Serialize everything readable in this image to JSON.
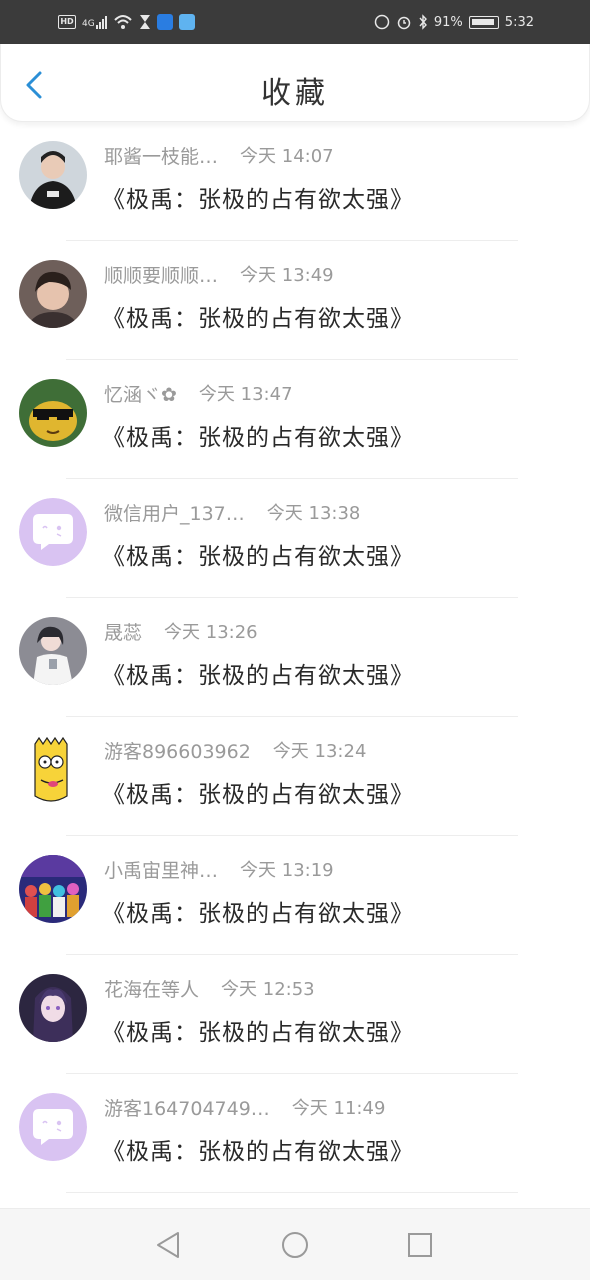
{
  "status_bar": {
    "hd": "HD",
    "network": "4G",
    "battery": "91%",
    "time": "5:32"
  },
  "header": {
    "title": "收藏"
  },
  "items": [
    {
      "name": "耶酱一枝能…",
      "time": "今天 14:07",
      "message": "《极禹：张极的占有欲太强》"
    },
    {
      "name": "顺顺要顺顺…",
      "time": "今天 13:49",
      "message": "《极禹：张极的占有欲太强》"
    },
    {
      "name": "忆涵ヾ✿",
      "time": "今天 13:47",
      "message": "《极禹：张极的占有欲太强》"
    },
    {
      "name": "微信用户_137…",
      "time": "今天 13:38",
      "message": "《极禹：张极的占有欲太强》"
    },
    {
      "name": "晟蕊",
      "time": "今天 13:26",
      "message": "《极禹：张极的占有欲太强》"
    },
    {
      "name": "游客896603962",
      "time": "今天 13:24",
      "message": "《极禹：张极的占有欲太强》"
    },
    {
      "name": "小禹宙里神…",
      "time": "今天 13:19",
      "message": "《极禹：张极的占有欲太强》"
    },
    {
      "name": "花海在等人",
      "time": "今天 12:53",
      "message": "《极禹：张极的占有欲太强》"
    },
    {
      "name": "游客164704749…",
      "time": "今天 11:49",
      "message": "《极禹：张极的占有欲太强》"
    }
  ],
  "colors": {
    "accent": "#2b8fd6",
    "default_avatar": "#d9c3f2"
  }
}
